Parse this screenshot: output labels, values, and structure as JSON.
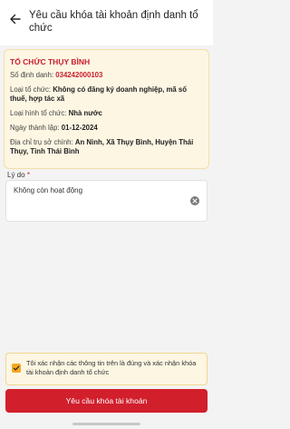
{
  "header": {
    "title": "Yêu cầu khóa tài khoản định danh tổ chức",
    "back_icon": "arrow-left-icon"
  },
  "org": {
    "name": "TỔ CHỨC THỤY BÌNH",
    "id_label": "Số định danh: ",
    "id_value": "034242000103",
    "type_label": "Loại tổ chức: ",
    "type_value": "Không có đăng ký doanh nghiệp, mã số thuế, hợp tác xã",
    "kind_label": "Loại hình tổ chức: ",
    "kind_value": "Nhà nước",
    "founded_label": "Ngày thành lập: ",
    "founded_value": "01-12-2024",
    "address_label": "Địa chỉ trụ sở chính: ",
    "address_value": "An Ninh, Xã Thụy Bình, Huyện Thái Thụy, Tỉnh Thái Bình"
  },
  "reason": {
    "label": "Lý do",
    "required_mark": "*",
    "value": "Không còn hoạt động",
    "clear_icon": "clear-icon"
  },
  "confirm": {
    "checked": true,
    "text": "Tôi xác nhận các thông tin trên là đúng và xác nhận khóa tài khoản định danh tổ chức"
  },
  "submit": {
    "label": "Yêu cầu khóa tài khoản"
  },
  "colors": {
    "accent": "#d11f2c",
    "card_bg": "#fdf6e3",
    "checkbox": "#f4a922"
  }
}
